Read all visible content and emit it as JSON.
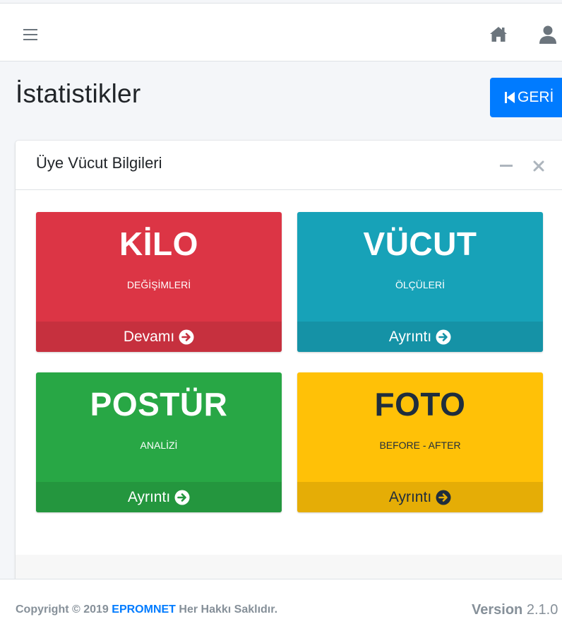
{
  "header": {
    "menu_icon": "hamburger-icon",
    "home_icon": "home-icon",
    "user_icon": "user-icon"
  },
  "page": {
    "title": "İstatistikler",
    "back_button": "GERİ"
  },
  "card": {
    "title": "Üye Vücut Bilgileri",
    "boxes": [
      {
        "title": "KİLO",
        "subtitle": "DEĞİŞİMLERİ",
        "link": "Devamı",
        "color": "#dc3545"
      },
      {
        "title": "VÜCUT",
        "subtitle": "ÖLÇÜLERİ",
        "link": "Ayrıntı",
        "color": "#17a2b8"
      },
      {
        "title": "POSTÜR",
        "subtitle": "ANALİZİ",
        "link": "Ayrıntı",
        "color": "#28a745"
      },
      {
        "title": "FOTO",
        "subtitle": "BEFORE - AFTER",
        "link": "Ayrıntı",
        "color": "#ffc107"
      }
    ]
  },
  "footer": {
    "copyright_prefix": "Copyright © 2019",
    "brand": "EPROMNET",
    "copyright_suffix": "Her Hakkı Saklıdır.",
    "version_label": "Version",
    "version_number": "2.1.0"
  },
  "colors": {
    "primary": "#007bff",
    "danger": "#dc3545",
    "info": "#17a2b8",
    "success": "#28a745",
    "warning": "#ffc107"
  }
}
